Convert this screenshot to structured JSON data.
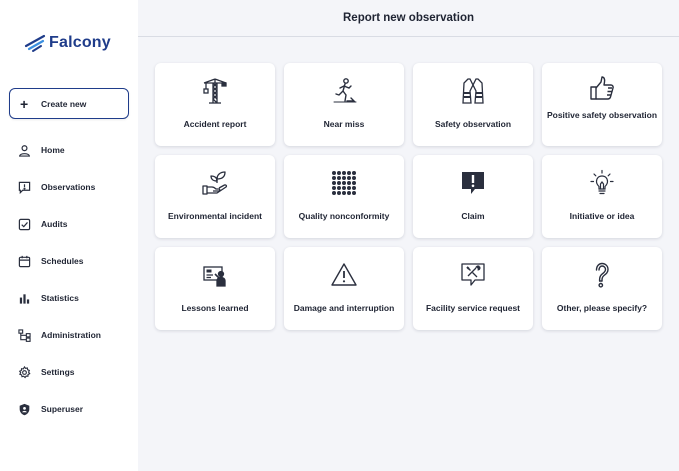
{
  "brand": {
    "name": "Falcony",
    "color": "#1f3c8a"
  },
  "sidebar": {
    "create_label": "Create new",
    "items": [
      {
        "label": "Home",
        "icon": "person-icon"
      },
      {
        "label": "Observations",
        "icon": "message-alert-icon"
      },
      {
        "label": "Audits",
        "icon": "checkbox-icon"
      },
      {
        "label": "Schedules",
        "icon": "calendar-icon"
      },
      {
        "label": "Statistics",
        "icon": "bar-chart-icon"
      },
      {
        "label": "Administration",
        "icon": "hierarchy-icon"
      },
      {
        "label": "Settings",
        "icon": "gear-icon"
      },
      {
        "label": "Superuser",
        "icon": "shield-icon"
      }
    ]
  },
  "header": {
    "title": "Report new observation"
  },
  "categories": [
    {
      "label": "Accident report",
      "icon": "construction-crane-icon"
    },
    {
      "label": "Near miss",
      "icon": "stumbling-person-icon"
    },
    {
      "label": "Safety observation",
      "icon": "safety-vest-icon"
    },
    {
      "label": "Positive safety observation",
      "icon": "thumbs-up-icon"
    },
    {
      "label": "Environmental incident",
      "icon": "hand-plant-icon"
    },
    {
      "label": "Quality nonconformity",
      "icon": "dot-grid-icon"
    },
    {
      "label": "Claim",
      "icon": "alert-message-icon"
    },
    {
      "label": "Initiative or idea",
      "icon": "lightbulb-icon"
    },
    {
      "label": "Lessons learned",
      "icon": "presentation-icon"
    },
    {
      "label": "Damage and interruption",
      "icon": "warning-triangle-icon"
    },
    {
      "label": "Facility service request",
      "icon": "tools-message-icon"
    },
    {
      "label": "Other, please specify?",
      "icon": "question-mark-icon"
    }
  ]
}
